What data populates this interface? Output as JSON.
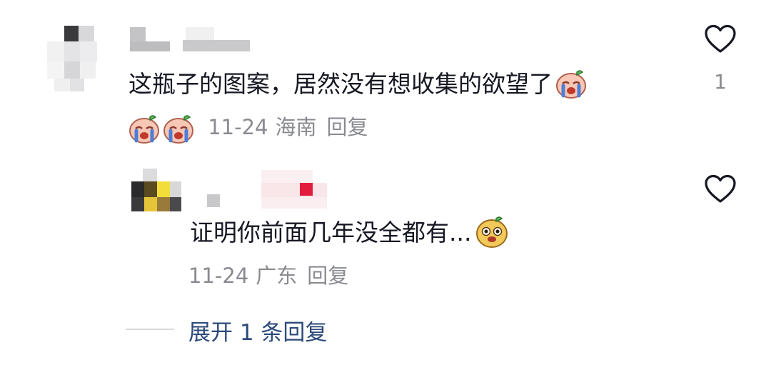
{
  "comments": [
    {
      "text": "这瓶子的图案，居然没有想收集的欲望了",
      "date": "11-24",
      "location": "海南",
      "reply_label": "回复",
      "like_count": "1",
      "emoji": "crying-face-emoji"
    },
    {
      "text": "证明你前面几年没全都有...",
      "date": "11-24",
      "location": "广东",
      "reply_label": "回复",
      "emoji": "meerkat-face-emoji"
    }
  ],
  "expand_replies": "展开 1 条回复",
  "icons": {
    "like": "heart-outline-icon"
  },
  "colors": {
    "text": "#161823",
    "meta": "#8a8b91",
    "link": "#2c4a7a",
    "divider": "#d9d9dc"
  }
}
